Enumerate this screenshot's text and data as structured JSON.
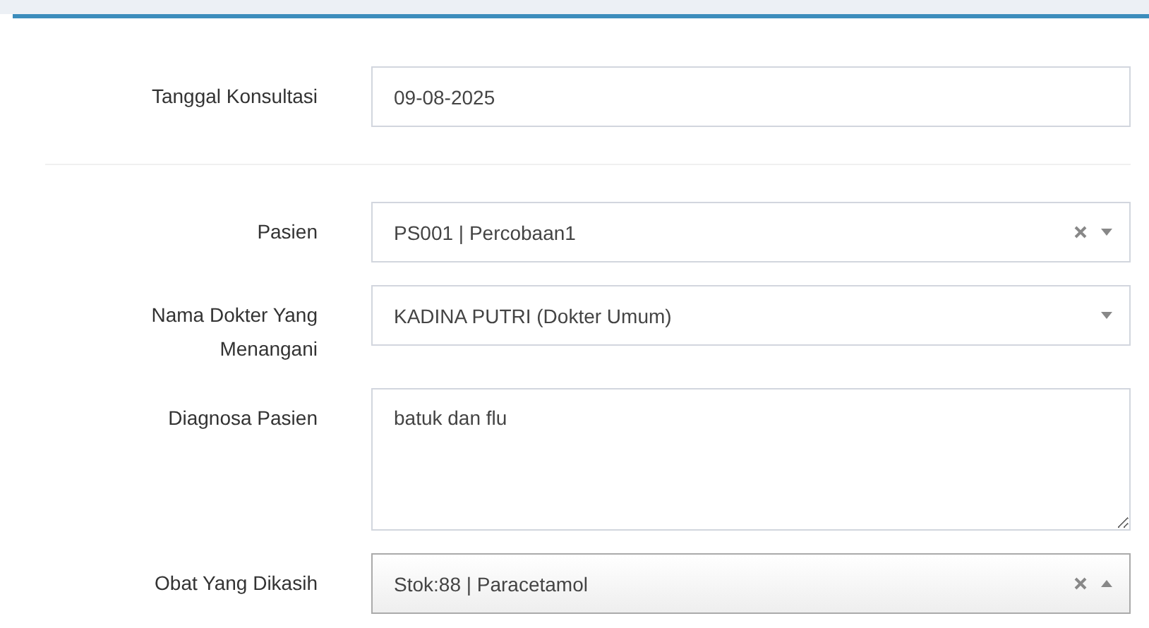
{
  "sections": [
    {
      "fields": [
        {
          "kind": "text",
          "label": "Tanggal Konsultasi",
          "value": "09-08-2025"
        }
      ]
    },
    {
      "fields": [
        {
          "kind": "select",
          "label": "Pasien",
          "value": "PS001 | Percobaan1",
          "clearable": true,
          "expanded": false
        },
        {
          "kind": "select",
          "label": "Nama Dokter Yang Menangani",
          "value": "KADINA PUTRI (Dokter Umum)",
          "clearable": false,
          "expanded": false
        },
        {
          "kind": "textarea",
          "label": "Diagnosa Pasien",
          "value": "batuk dan flu"
        },
        {
          "kind": "select",
          "label": "Obat Yang Dikasih",
          "value": "Stok:88 | Paracetamol",
          "clearable": true,
          "expanded": true
        }
      ]
    }
  ]
}
